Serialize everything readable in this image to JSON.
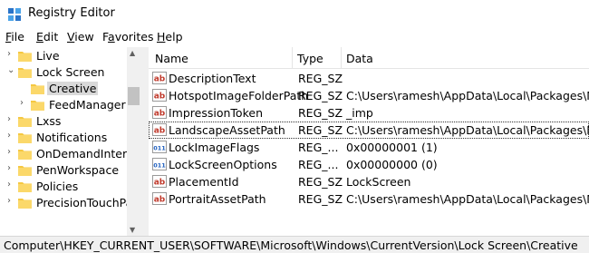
{
  "window": {
    "title": "Registry Editor"
  },
  "menu": [
    {
      "key": "F",
      "rest": "ile"
    },
    {
      "key": "E",
      "rest": "dit"
    },
    {
      "key": "V",
      "rest": "iew"
    },
    {
      "pre": "F",
      "key": "a",
      "rest": "vorites"
    },
    {
      "key": "H",
      "rest": "elp"
    }
  ],
  "tree": [
    {
      "label": "Live",
      "arrow": ">"
    },
    {
      "label": "Lock Screen",
      "arrow": "v"
    },
    {
      "label": "Creative",
      "arrow": "",
      "selected": true
    },
    {
      "label": "FeedManager",
      "arrow": ">"
    },
    {
      "label": "Lxss",
      "arrow": ">"
    },
    {
      "label": "Notifications",
      "arrow": ">"
    },
    {
      "label": "OnDemandInterfa",
      "arrow": ">"
    },
    {
      "label": "PenWorkspace",
      "arrow": ">"
    },
    {
      "label": "Policies",
      "arrow": ">"
    },
    {
      "label": "PrecisionTouchPa",
      "arrow": ">"
    }
  ],
  "columns": {
    "name": "Name",
    "type": "Type",
    "data": "Data"
  },
  "rows": [
    {
      "name": "DescriptionText",
      "type": "REG_SZ",
      "data": "",
      "icon": "string-value-icon"
    },
    {
      "name": "HotspotImageFolderPath",
      "type": "REG_SZ",
      "data": "C:\\Users\\ramesh\\AppData\\Local\\Packages\\Micros",
      "icon": "string-value-icon"
    },
    {
      "name": "ImpressionToken",
      "type": "REG_SZ",
      "data": "_imp",
      "icon": "string-value-icon"
    },
    {
      "name": "LandscapeAssetPath",
      "type": "REG_SZ",
      "data": "C:\\Users\\ramesh\\AppData\\Local\\Packages\\Micros",
      "icon": "string-value-icon",
      "focused": true
    },
    {
      "name": "LockImageFlags",
      "type": "REG_...",
      "data": "0x00000001 (1)",
      "icon": "binary-value-icon"
    },
    {
      "name": "LockScreenOptions",
      "type": "REG_...",
      "data": "0x00000000 (0)",
      "icon": "binary-value-icon"
    },
    {
      "name": "PlacementId",
      "type": "REG_SZ",
      "data": "LockScreen",
      "icon": "string-value-icon"
    },
    {
      "name": "PortraitAssetPath",
      "type": "REG_SZ",
      "data": "C:\\Users\\ramesh\\AppData\\Local\\Packages\\Micros",
      "icon": "string-value-icon"
    }
  ],
  "status": "Computer\\HKEY_CURRENT_USER\\SOFTWARE\\Microsoft\\Windows\\CurrentVersion\\Lock Screen\\Creative",
  "colors": {
    "folder": "#f5c842",
    "string_icon": "#c0392b",
    "binary_icon": "#1f5fbf",
    "selected_bg": "#d9d9d9"
  }
}
